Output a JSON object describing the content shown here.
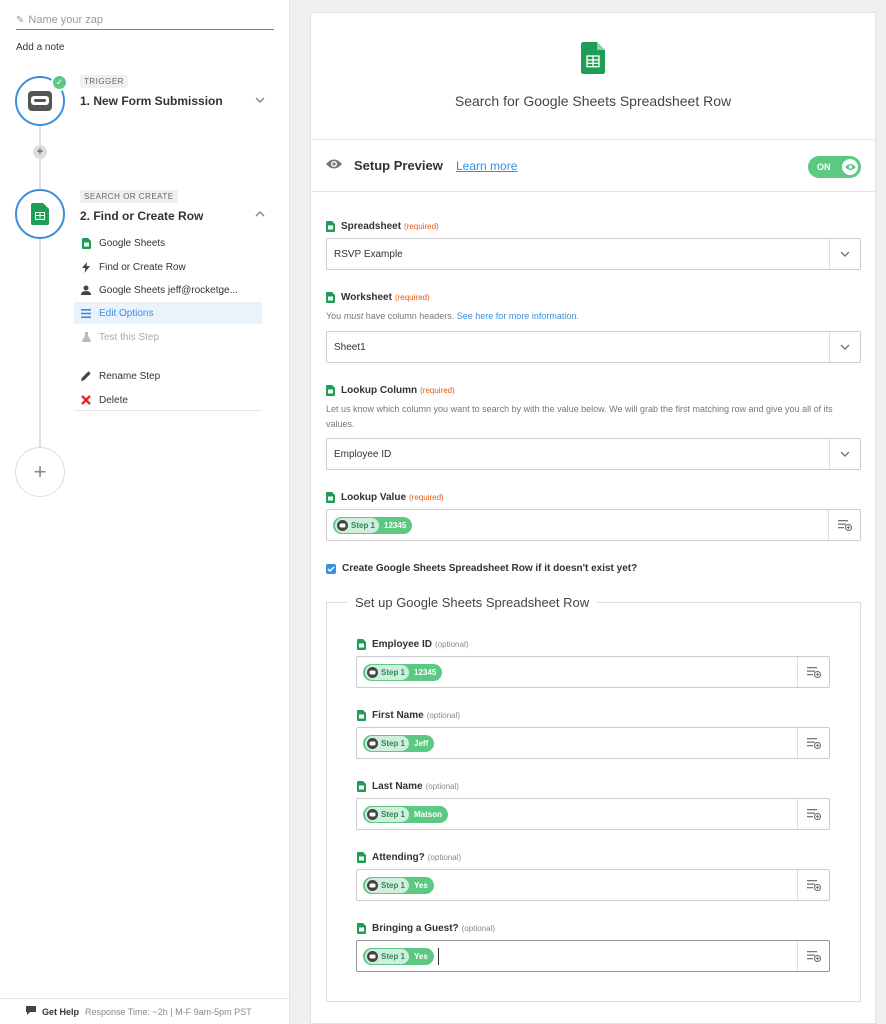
{
  "sidebar": {
    "zap_name_placeholder": "Name your zap",
    "add_note": "Add a note",
    "trigger": {
      "tag": "TRIGGER",
      "title": "1. New Form Submission"
    },
    "action": {
      "tag": "SEARCH OR CREATE",
      "title": "2. Find or Create Row",
      "items": [
        {
          "label": "Google Sheets",
          "icon": "google-sheets-icon"
        },
        {
          "label": "Find or Create Row",
          "icon": "bolt-icon"
        },
        {
          "label": "Google Sheets jeff@rocketge...",
          "icon": "user-icon"
        },
        {
          "label": "Edit Options",
          "icon": "list-icon"
        },
        {
          "label": "Test this Step",
          "icon": "flask-icon"
        },
        {
          "label": "Rename Step",
          "icon": "pencil-icon"
        },
        {
          "label": "Delete",
          "icon": "x-icon"
        }
      ]
    },
    "help": {
      "label": "Get Help",
      "response": "Response Time: ~2h | M-F 9am-5pm PST"
    }
  },
  "main": {
    "title": "Search for Google Sheets Spreadsheet Row",
    "preview": {
      "title": "Setup Preview",
      "learn_more": "Learn more",
      "toggle": "ON"
    },
    "fields": {
      "spreadsheet": {
        "label": "Spreadsheet",
        "tag": "(required)",
        "value": "RSVP Example"
      },
      "worksheet": {
        "label": "Worksheet",
        "tag": "(required)",
        "help_pre": "You ",
        "help_em": "must",
        "help_mid": " have column headers. ",
        "help_link": "See here for more information.",
        "value": "Sheet1"
      },
      "lookup_column": {
        "label": "Lookup Column",
        "tag": "(required)",
        "help": "Let us know which column you want to search by with the value below. We will grab the first matching row and give you all of its values.",
        "value": "Employee ID"
      },
      "lookup_value": {
        "label": "Lookup Value",
        "tag": "(required)",
        "step": "Step 1",
        "token": "12345"
      }
    },
    "create_checkbox": "Create Google Sheets Spreadsheet Row if it doesn't exist yet?",
    "row_setup": {
      "legend": "Set up Google Sheets Spreadsheet Row",
      "rows": [
        {
          "label": "Employee ID",
          "tag": "(optional)",
          "step": "Step 1",
          "token": "12345"
        },
        {
          "label": "First Name",
          "tag": "(optional)",
          "step": "Step 1",
          "token": "Jeff"
        },
        {
          "label": "Last Name",
          "tag": "(optional)",
          "step": "Step 1",
          "token": "Matson"
        },
        {
          "label": "Attending?",
          "tag": "(optional)",
          "step": "Step 1",
          "token": "Yes"
        },
        {
          "label": "Bringing a Guest?",
          "tag": "(optional)",
          "step": "Step 1",
          "token": "Yes"
        }
      ]
    }
  },
  "colors": {
    "accent": "#3a8fdc",
    "green": "#5bc982",
    "required": "#e8590c"
  }
}
